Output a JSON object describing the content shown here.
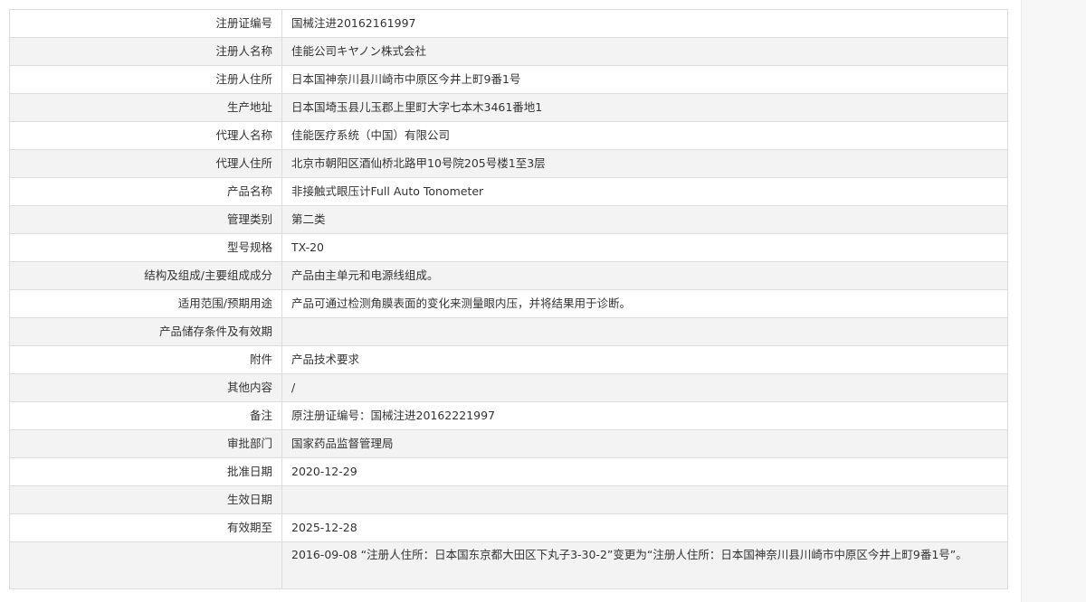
{
  "rows": [
    {
      "label": "注册证编号",
      "value": "国械注进20162161997"
    },
    {
      "label": "注册人名称",
      "value": "佳能公司キヤノン株式会社"
    },
    {
      "label": "注册人住所",
      "value": "日本国神奈川县川崎市中原区今井上町9番1号"
    },
    {
      "label": "生产地址",
      "value": "日本国埼玉县儿玉郡上里町大字七本木3461番地1"
    },
    {
      "label": "代理人名称",
      "value": "佳能医疗系统（中国）有限公司"
    },
    {
      "label": "代理人住所",
      "value": "北京市朝阳区酒仙桥北路甲10号院205号楼1至3层"
    },
    {
      "label": "产品名称",
      "value": "非接触式眼压计Full Auto Tonometer"
    },
    {
      "label": "管理类别",
      "value": "第二类"
    },
    {
      "label": "型号规格",
      "value": "TX-20"
    },
    {
      "label": "结构及组成/主要组成成分",
      "value": "产品由主单元和电源线组成。"
    },
    {
      "label": "适用范围/预期用途",
      "value": "产品可通过检测角膜表面的变化来测量眼内压，并将结果用于诊断。"
    },
    {
      "label": "产品储存条件及有效期",
      "value": ""
    },
    {
      "label": "附件",
      "value": "产品技术要求"
    },
    {
      "label": "其他内容",
      "value": "/"
    },
    {
      "label": "备注",
      "value": "原注册证编号：国械注进20162221997"
    },
    {
      "label": "审批部门",
      "value": "国家药品监督管理局"
    },
    {
      "label": "批准日期",
      "value": "2020-12-29"
    },
    {
      "label": "生效日期",
      "value": ""
    },
    {
      "label": "有效期至",
      "value": "2025-12-28"
    },
    {
      "label": "",
      "value": "2016-09-08 “注册人住所：日本国东京都大田区下丸子3-30-2”变更为“注册人住所：日本国神奈川县川崎市中原区今井上町9番1号”。"
    }
  ]
}
